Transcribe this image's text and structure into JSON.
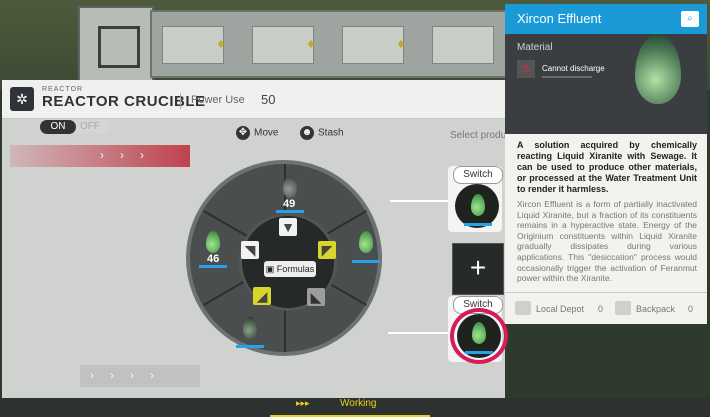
{
  "facility": {
    "sub_label": "REACTOR",
    "title": "REACTOR CRUCIBLE",
    "power_label": "Power Use",
    "power_value": "50"
  },
  "toggle": {
    "on_label": "ON",
    "off_label": "OFF",
    "state": "on"
  },
  "actions": {
    "move_label": "Move",
    "stash_label": "Stash"
  },
  "select_product_label": "Select produ",
  "ring": {
    "center_label": "Formulas",
    "slots": [
      {
        "position": "top",
        "value": "49",
        "fluid": "gray"
      },
      {
        "position": "left",
        "value": "46",
        "fluid": "green"
      },
      {
        "position": "right",
        "value": "",
        "fluid": "green"
      },
      {
        "position": "bottom-left",
        "value": "",
        "fluid": "dark"
      }
    ]
  },
  "outputs": [
    {
      "switch_label": "Switch"
    },
    {
      "switch_label": "Switch"
    }
  ],
  "status": {
    "label": "Working"
  },
  "tooltip": {
    "title": "Xircon Effluent",
    "type": "Material",
    "warning": "Cannot discharge",
    "description": "A solution acquired by chemically reacting Liquid Xiranite with Sewage. It can be used to produce other materials, or processed at the Water Treatment Unit to render it harmless.",
    "lore": "Xircon Effluent is a form of partially inactivated Liquid Xiranite, but a fraction of its constituents remains in a hyperactive state. Energy of the Originium constituents within Liquid Xiranite gradually dissipates during various applications. This \"desiccation\" process would occasionally trigger the activation of Feranmut power within the Xiranite.",
    "local_depot_label": "Local Depot",
    "local_depot_count": "0",
    "backpack_label": "Backpack",
    "backpack_count": "0"
  },
  "colors": {
    "accent_blue": "#1a9ad6",
    "status_yellow": "#e6d21e",
    "highlight_pink": "#d61a5a",
    "level_bar": "#2aa0e8"
  },
  "icons": [
    "move-icon",
    "stash-icon",
    "formulas-icon",
    "cannot-discharge-icon",
    "inspect-icon",
    "local-depot-icon",
    "backpack-icon",
    "plus-icon",
    "play-icon"
  ]
}
